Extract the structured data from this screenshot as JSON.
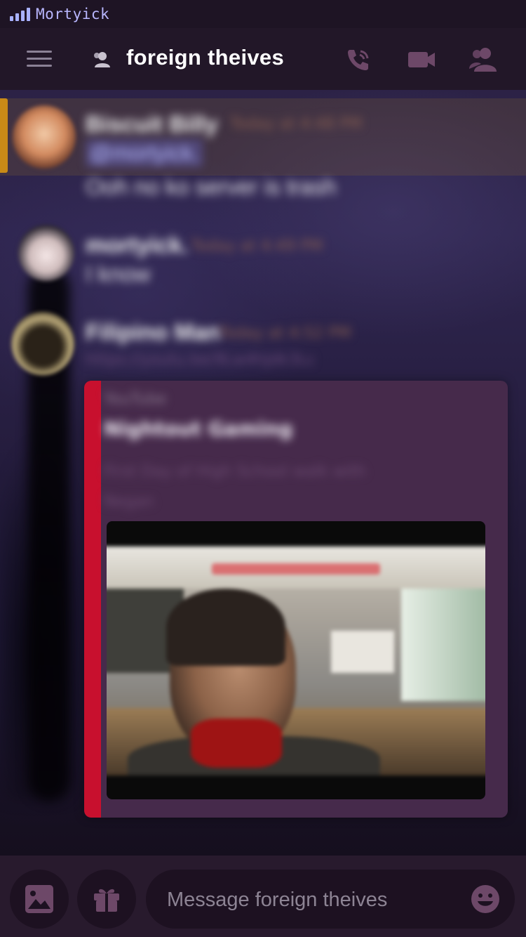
{
  "status_bar": {
    "carrier": "Mortyick",
    "signal_color": "#a9b2ff"
  },
  "header": {
    "channel_name": "foreign theives",
    "icons": [
      "menu-icon",
      "members-icon",
      "call-icon",
      "video-call-icon",
      "member-list-icon"
    ]
  },
  "messages": [
    {
      "username": "Biscuit Billy",
      "timestamp": "Today at 4:48 PM",
      "mention": "@mortyick.",
      "text": "Ooh no ko server is trash",
      "highlighted": true,
      "highlight_color": "#c98a17"
    },
    {
      "username": "mortyick.",
      "timestamp": "Today at 4:49 PM",
      "text": "I know"
    },
    {
      "username": "Filipino Man",
      "timestamp": "Today at 4:52 PM",
      "link": "https://youtu.be/9Lw4hJdk3Lc",
      "embed": {
        "provider": "YouTube",
        "title": "Nightout Gaming",
        "description": "First Day of High School walk with Negan",
        "accent_color": "#c8102e"
      }
    }
  ],
  "composer": {
    "placeholder": "Message foreign theives",
    "icons": [
      "image-icon",
      "gift-icon",
      "emoji-icon"
    ]
  }
}
